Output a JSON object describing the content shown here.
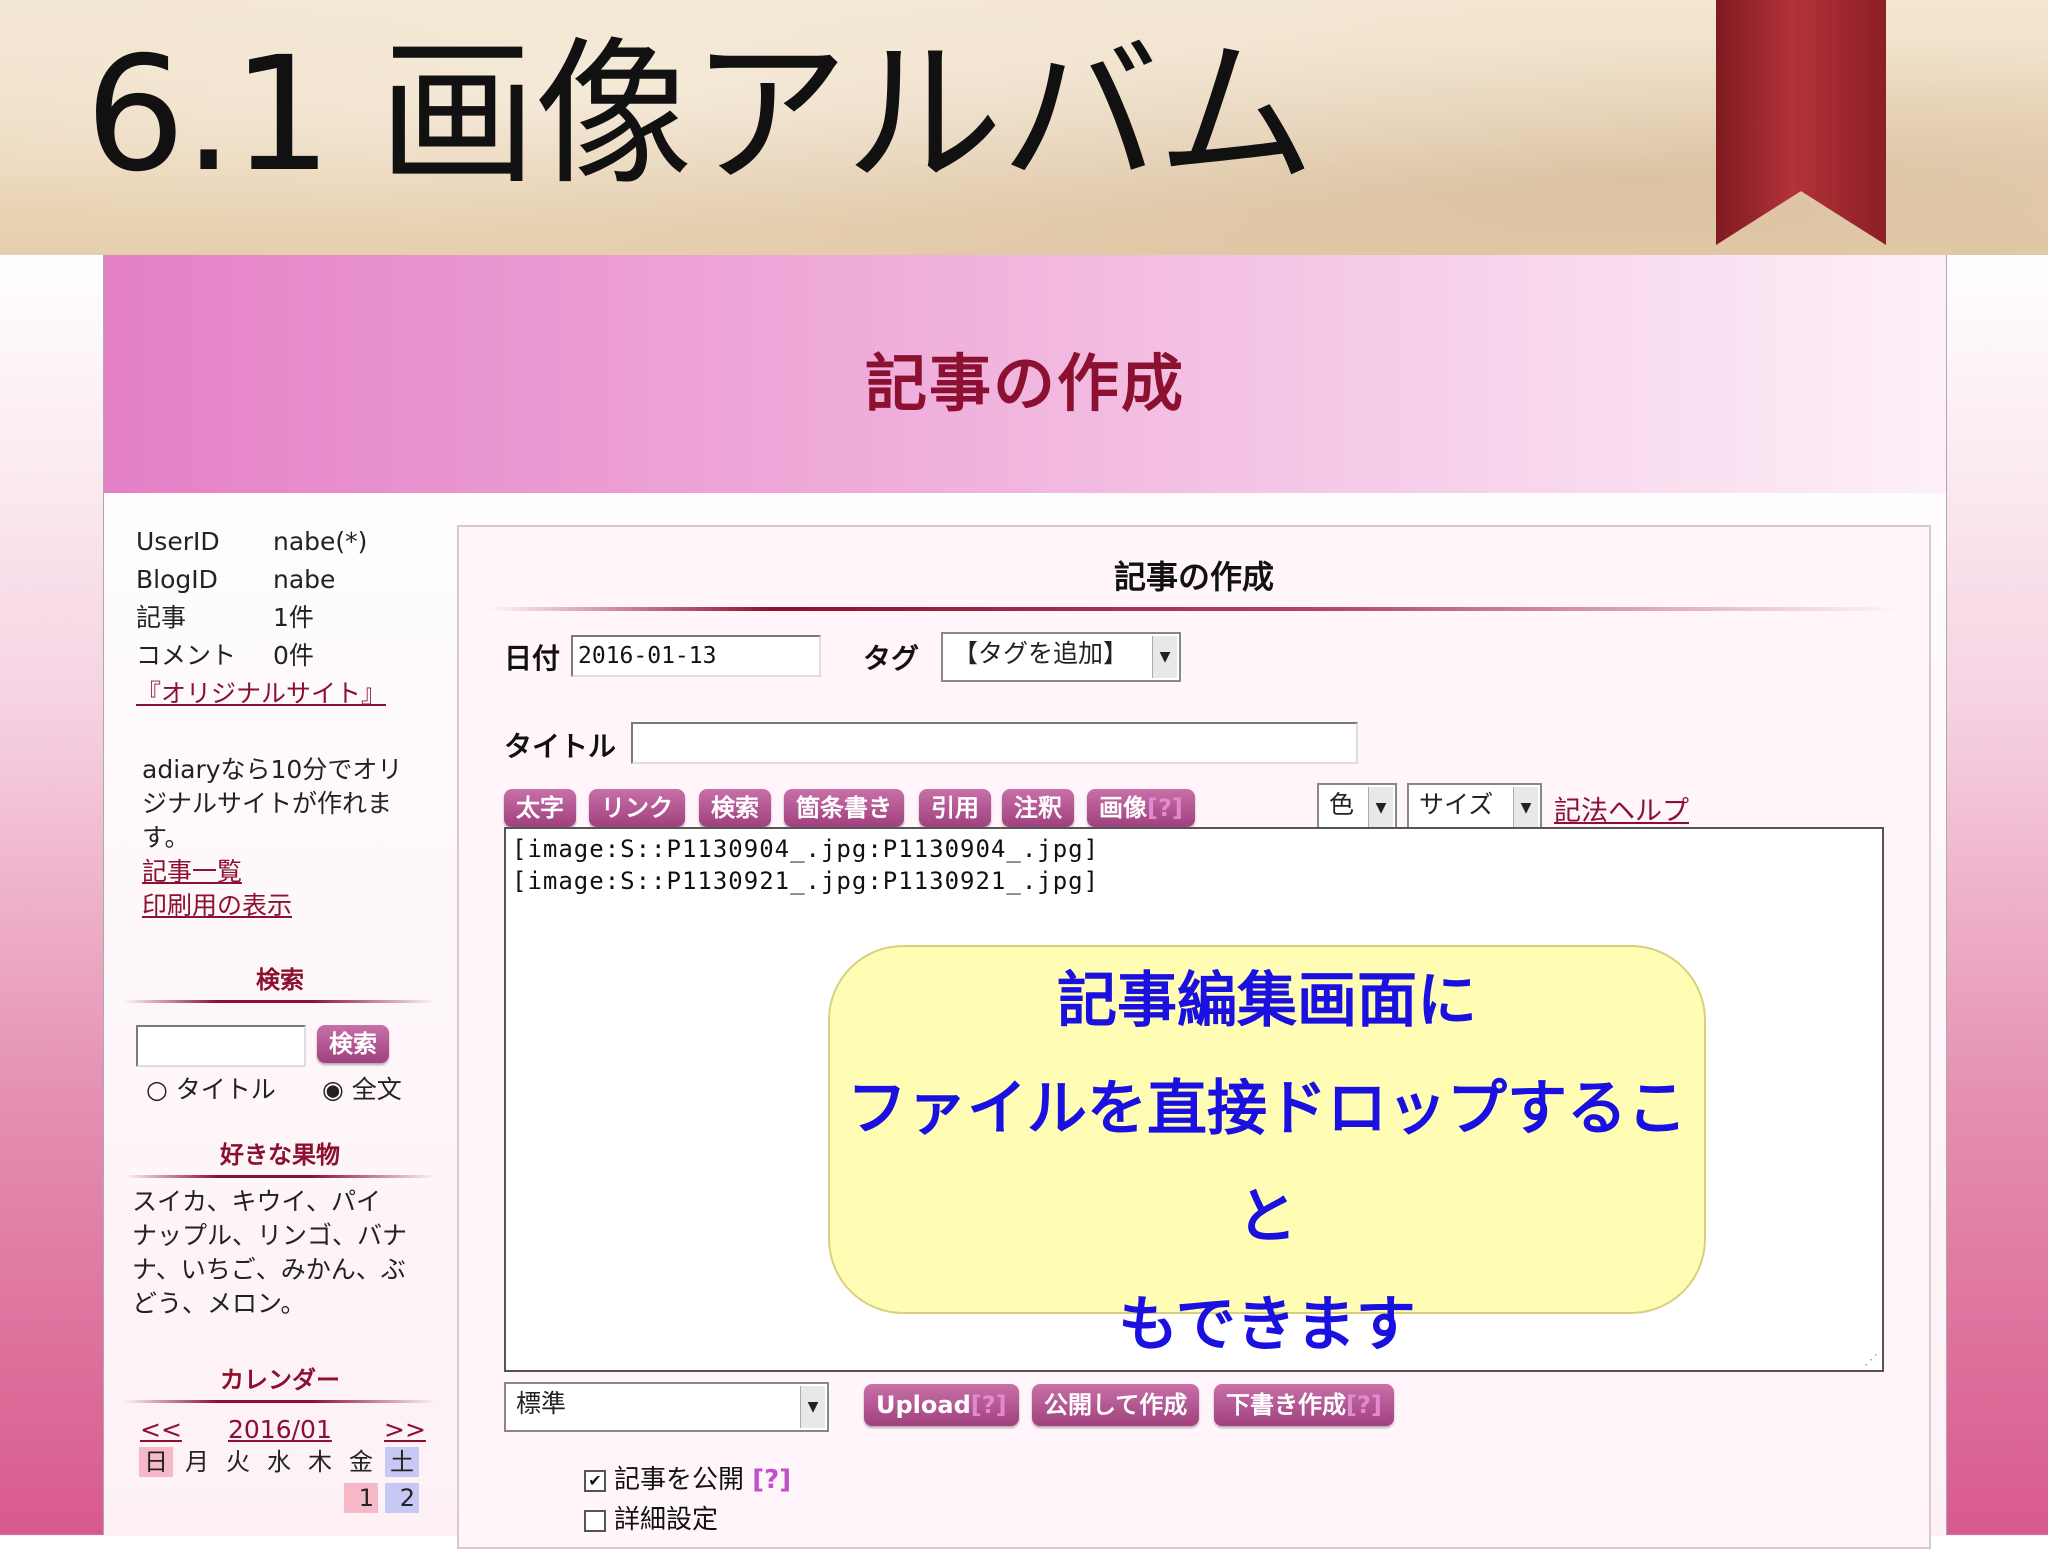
{
  "slide": {
    "title": "6.1 画像アルバム"
  },
  "banner": {
    "title": "記事の作成"
  },
  "sidebar": {
    "info": [
      {
        "key": "UserID",
        "value": "nabe(*)"
      },
      {
        "key": "BlogID",
        "value": "nabe"
      },
      {
        "key": "記事",
        "value": "1件"
      },
      {
        "key": "コメント",
        "value": "0件"
      }
    ],
    "original_site_link": "『オリジナルサイト』",
    "promo_lines": [
      "adiaryなら10分でオリ",
      "ジナルサイトが作れま",
      "す。"
    ],
    "links": [
      "記事一覧",
      "印刷用の表示"
    ],
    "search": {
      "heading": "検索",
      "button": "検索",
      "option_title": "タイトル",
      "option_fulltext": "全文"
    },
    "fruits": {
      "heading": "好きな果物",
      "lines": [
        "スイカ、キウイ、パイ",
        "ナップル、リンゴ、バナ",
        "ナ、いちご、みかん、ぶ",
        "どう、メロン。"
      ]
    },
    "calendar": {
      "heading": "カレンダー",
      "prev": "<<",
      "month": "2016/01",
      "next": ">>",
      "weekdays": [
        "日",
        "月",
        "火",
        "水",
        "木",
        "金",
        "土"
      ],
      "first_row": [
        "1",
        "2"
      ]
    }
  },
  "form": {
    "heading": "記事の作成",
    "date_label": "日付",
    "date_value": "2016-01-13",
    "tag_label": "タグ",
    "tag_select": "【タグを追加】",
    "title_label": "タイトル",
    "toolbar": [
      "太字",
      "リンク",
      "検索",
      "箇条書き",
      "引用",
      "注釈"
    ],
    "image_button": "画像",
    "help_mark": "[?]",
    "color_select": "色",
    "size_select": "サイズ",
    "syntax_help": "記法ヘルプ",
    "editor_lines": [
      "[image:S::P1130904_.jpg:P1130904_.jpg]",
      "[image:S::P1130921_.jpg:P1130921_.jpg]"
    ],
    "format_select": "標準",
    "upload_button": "Upload",
    "publish_button": "公開して作成",
    "draft_button": "下書き作成",
    "publish_checkbox": "記事を公開",
    "detail_checkbox": "詳細設定"
  },
  "callout": {
    "lines": [
      "記事編集画面に",
      "ファイルを直接ドロップすること",
      "もできます"
    ]
  }
}
